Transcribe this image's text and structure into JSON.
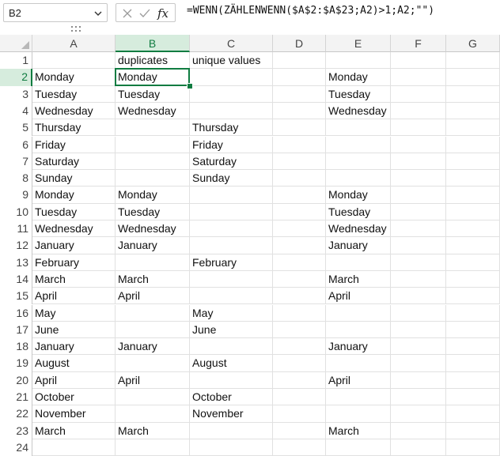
{
  "name_box": {
    "value": "B2"
  },
  "formula": {
    "value": "=WENN(ZÄHLENWENN($A$2:$A$23;A2)>1;A2;\"\")"
  },
  "columns": [
    "A",
    "B",
    "C",
    "D",
    "E",
    "F",
    "G"
  ],
  "rows": [
    {
      "n": "1",
      "a": "",
      "b": "duplicates",
      "c": "unique values",
      "e": ""
    },
    {
      "n": "2",
      "a": "Monday",
      "b": "Monday",
      "c": "",
      "e": "Monday"
    },
    {
      "n": "3",
      "a": "Tuesday",
      "b": "Tuesday",
      "c": "",
      "e": "Tuesday"
    },
    {
      "n": "4",
      "a": "Wednesday",
      "b": "Wednesday",
      "c": "",
      "e": "Wednesday"
    },
    {
      "n": "5",
      "a": "Thursday",
      "b": "",
      "c": "Thursday",
      "e": ""
    },
    {
      "n": "6",
      "a": "Friday",
      "b": "",
      "c": "Friday",
      "e": ""
    },
    {
      "n": "7",
      "a": "Saturday",
      "b": "",
      "c": "Saturday",
      "e": ""
    },
    {
      "n": "8",
      "a": "Sunday",
      "b": "",
      "c": "Sunday",
      "e": ""
    },
    {
      "n": "9",
      "a": "Monday",
      "b": "Monday",
      "c": "",
      "e": "Monday"
    },
    {
      "n": "10",
      "a": "Tuesday",
      "b": "Tuesday",
      "c": "",
      "e": "Tuesday"
    },
    {
      "n": "11",
      "a": "Wednesday",
      "b": "Wednesday",
      "c": "",
      "e": "Wednesday"
    },
    {
      "n": "12",
      "a": "January",
      "b": "January",
      "c": "",
      "e": "January"
    },
    {
      "n": "13",
      "a": "February",
      "b": "",
      "c": "February",
      "e": ""
    },
    {
      "n": "14",
      "a": "March",
      "b": "March",
      "c": "",
      "e": "March"
    },
    {
      "n": "15",
      "a": "April",
      "b": "April",
      "c": "",
      "e": "April"
    },
    {
      "n": "16",
      "a": "May",
      "b": "",
      "c": "May",
      "e": ""
    },
    {
      "n": "17",
      "a": "June",
      "b": "",
      "c": "June",
      "e": ""
    },
    {
      "n": "18",
      "a": "January",
      "b": "January",
      "c": "",
      "e": "January"
    },
    {
      "n": "19",
      "a": "August",
      "b": "",
      "c": "August",
      "e": ""
    },
    {
      "n": "20",
      "a": "April",
      "b": "April",
      "c": "",
      "e": "April"
    },
    {
      "n": "21",
      "a": "October",
      "b": "",
      "c": "October",
      "e": ""
    },
    {
      "n": "22",
      "a": "November",
      "b": "",
      "c": "November",
      "e": ""
    },
    {
      "n": "23",
      "a": "March",
      "b": "March",
      "c": "",
      "e": "March"
    },
    {
      "n": "24",
      "a": "",
      "b": "",
      "c": "",
      "e": ""
    }
  ],
  "selection": {
    "column": "B",
    "row": "2"
  },
  "colors": {
    "accent": "#107c41",
    "header_selected_bg": "#d6ecdd"
  }
}
